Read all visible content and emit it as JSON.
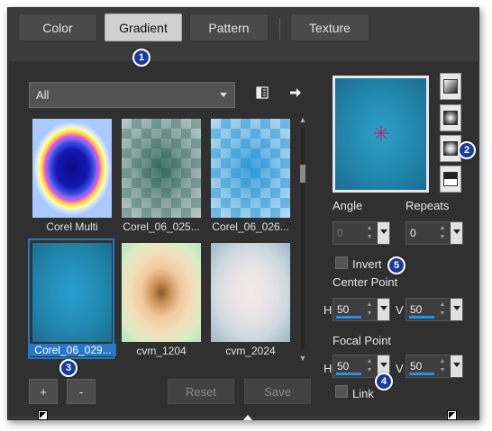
{
  "tabs": [
    {
      "label": "Color"
    },
    {
      "label": "Gradient"
    },
    {
      "label": "Pattern"
    },
    {
      "label": "Texture"
    }
  ],
  "category_dropdown": {
    "value": "All"
  },
  "gradients": [
    {
      "name": "Corel Multi",
      "selected": false
    },
    {
      "name": "Corel_06_025...",
      "selected": false
    },
    {
      "name": "Corel_06_026...",
      "selected": false
    },
    {
      "name": "Corel_06_029...",
      "selected": true
    },
    {
      "name": "cvm_1204",
      "selected": false
    },
    {
      "name": "cvm_2024",
      "selected": false
    }
  ],
  "buttons": {
    "add": "+",
    "remove": "-",
    "reset": "Reset",
    "save": "Save"
  },
  "angle": {
    "label": "Angle",
    "value": "0"
  },
  "repeats": {
    "label": "Repeats",
    "value": "0"
  },
  "invert": {
    "label": "Invert",
    "checked": false
  },
  "center_point": {
    "label": "Center Point",
    "h_label": "H",
    "h_value": "50",
    "v_label": "V",
    "v_value": "50"
  },
  "focal_point": {
    "label": "Focal Point",
    "h_label": "H",
    "h_value": "50",
    "v_label": "V",
    "v_value": "50"
  },
  "link": {
    "label": "Link",
    "checked": false
  },
  "callouts": [
    "1",
    "2",
    "3",
    "4",
    "5"
  ],
  "colors": {
    "accent": "#2878c8",
    "callout": "#1a3b9c",
    "panel": "#303030",
    "dialog": "#3b3b3b"
  }
}
